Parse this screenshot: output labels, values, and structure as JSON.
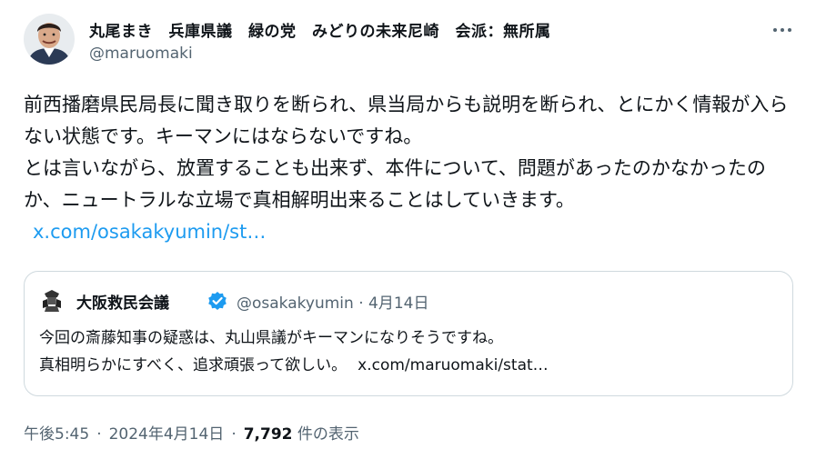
{
  "author": {
    "display_name": "丸尾まき　兵庫県議　緑の党　みどりの未来尼崎　会派：無所属",
    "handle": "@maruomaki"
  },
  "tweet": {
    "paragraph1": "前西播磨県民局長に聞き取りを断られ、県当局からも説明を断られ、とにかく情報が入らない状態です。キーマンにはならないですね。",
    "paragraph2": "とは言いながら、放置することも出来ず、本件について、問題があったのかなかったのか、ニュートラルな立場で真相解明出来ることはしていきます。",
    "link": "x.com/osakakyumin/st…"
  },
  "quoted": {
    "display_name": "大阪救民会議",
    "handle": "@osakakyumin",
    "separator": "·",
    "date": "4月14日",
    "line1": "今回の斎藤知事の疑惑は、丸山県議がキーマンになりそうですね。",
    "line2": "真相明らかにすべく、追求頑張って欲しい。",
    "link": "x.com/maruomaki/stat…"
  },
  "footer": {
    "time": "午後5:45",
    "sep1": "·",
    "date": "2024年4月14日",
    "sep2": "·",
    "view_count": "7,792",
    "view_label": "件の表示"
  },
  "icons": {
    "more": "more-horizontal-icon",
    "verified": "verified-badge-icon"
  },
  "colors": {
    "link": "#1d9bf0",
    "secondary_text": "#536471",
    "border": "#cfd9de",
    "verified": "#1d9bf0"
  }
}
